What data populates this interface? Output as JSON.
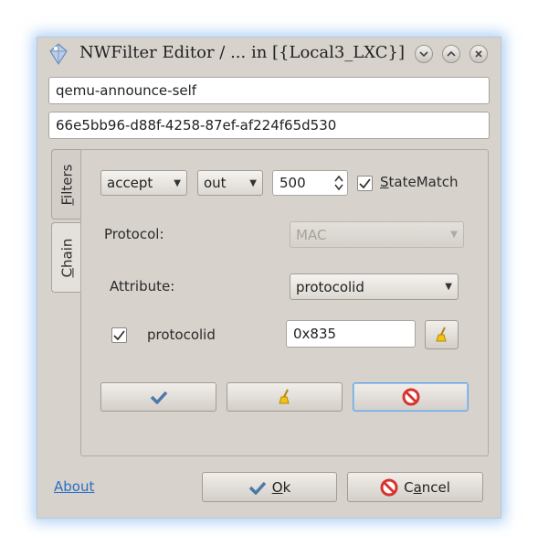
{
  "window": {
    "title": "NWFilter Editor / ... in [{Local3_LXC}]",
    "controls": [
      "minimize-icon",
      "restore-icon",
      "close-icon"
    ]
  },
  "filter_name": {
    "value": "qemu-announce-self"
  },
  "uuid": {
    "value": "66e5bb96-d88f-4258-87ef-af224f65d530"
  },
  "tabs": [
    {
      "label": "Filters",
      "mnemonic": "F"
    },
    {
      "label": "Chain",
      "mnemonic": "C"
    }
  ],
  "rule": {
    "action": {
      "selected": "accept"
    },
    "direction": {
      "selected": "out"
    },
    "priority": {
      "value": "500"
    },
    "statematch": {
      "label": "StateMatch",
      "mnemonic": "S",
      "checked": true
    }
  },
  "protocol": {
    "label": "Protocol:",
    "selected": "MAC",
    "disabled": true
  },
  "attribute": {
    "label": "Attribute:",
    "selected": "protocolid"
  },
  "attribute_row": {
    "checked": true,
    "label": "protocolid",
    "value": "0x835"
  },
  "actions": {
    "apply_icon": "checkmark-icon",
    "clear_icon": "broom-icon",
    "delete_icon": "no-entry-icon"
  },
  "footer": {
    "about_label": "About",
    "ok_label": "Ok",
    "ok_mnemonic": "O",
    "cancel_label": "Cancel",
    "cancel_mnemonic": "a"
  },
  "colors": {
    "window_bg": "#d7d2cc",
    "focus_border": "#6aa6e0",
    "link": "#2a6fc4",
    "cancel_red": "#d9332e"
  }
}
